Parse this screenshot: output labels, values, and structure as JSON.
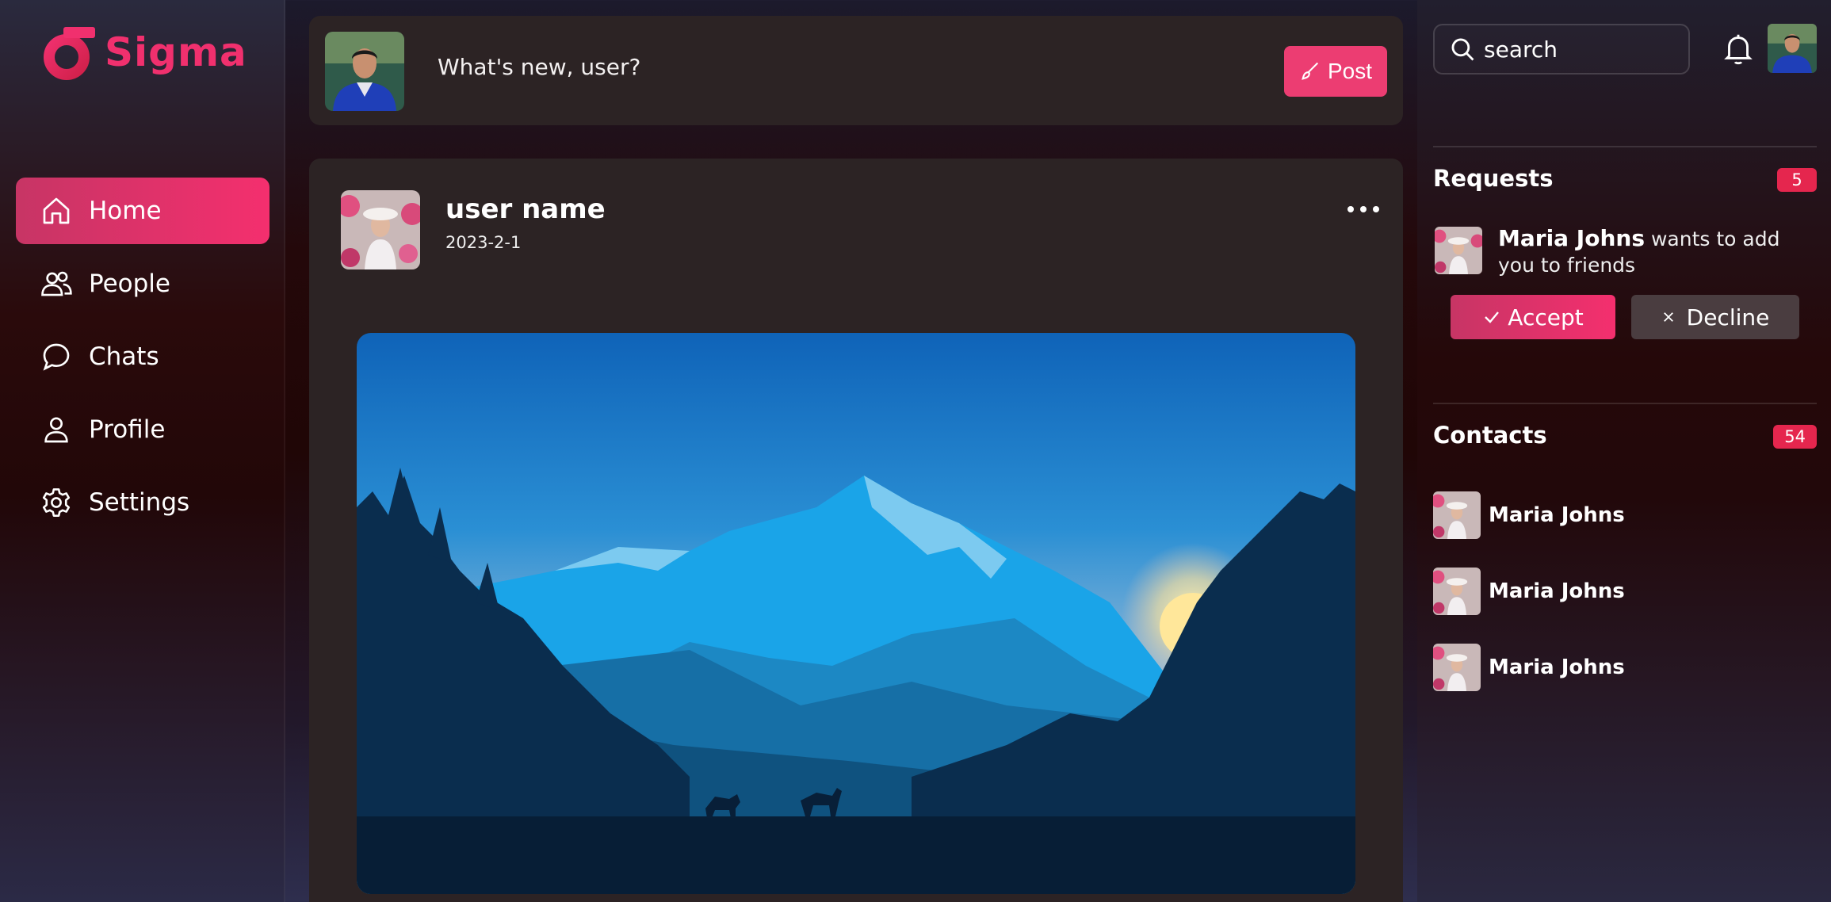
{
  "brand": {
    "name": "Sigma",
    "color": "#f0306e"
  },
  "sidebar": {
    "items": [
      {
        "label": "Home",
        "icon": "home-icon",
        "active": true
      },
      {
        "label": "People",
        "icon": "people-icon",
        "active": false
      },
      {
        "label": "Chats",
        "icon": "chat-icon",
        "active": false
      },
      {
        "label": "Profile",
        "icon": "profile-icon",
        "active": false
      },
      {
        "label": "Settings",
        "icon": "gear-icon",
        "active": false
      }
    ]
  },
  "composer": {
    "placeholder": "What's new, user?",
    "post_label": "Post"
  },
  "post": {
    "author": "user name",
    "date": "2023-2-1"
  },
  "header": {
    "search_placeholder": "search"
  },
  "requests": {
    "title": "Requests",
    "count": "5",
    "name": "Maria Johns",
    "message": "wants to add you to friends",
    "accept_label": "Accept",
    "decline_label": "Decline"
  },
  "contacts": {
    "title": "Contacts",
    "count": "54",
    "items": [
      {
        "name": "Maria Johns"
      },
      {
        "name": "Maria Johns"
      },
      {
        "name": "Maria Johns"
      }
    ]
  },
  "colors": {
    "accent": "#f42f6e",
    "badge": "#e5264e",
    "card": "#2c2324"
  }
}
